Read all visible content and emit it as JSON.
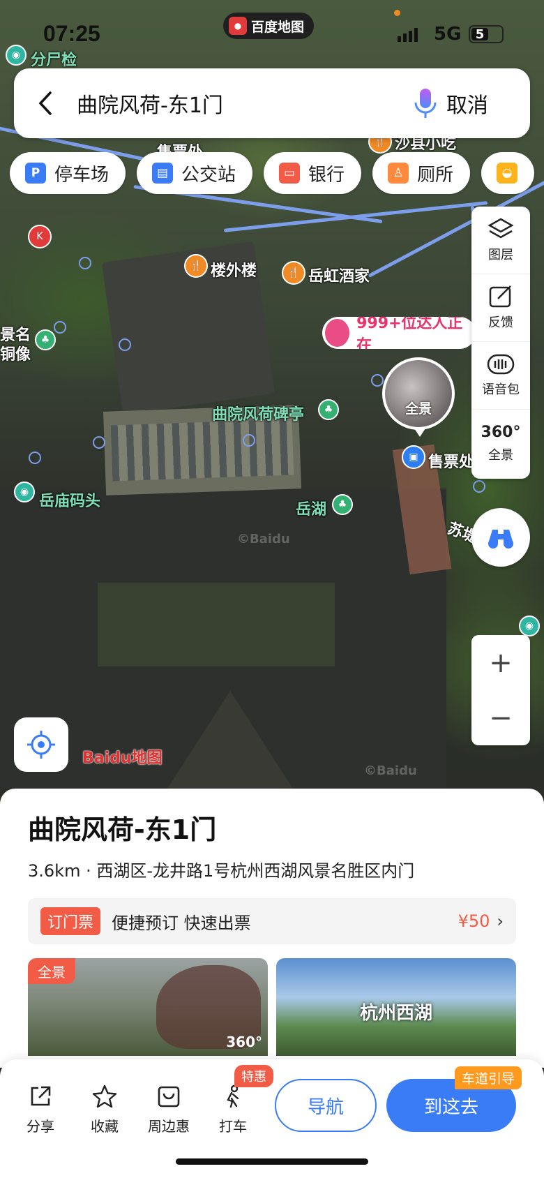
{
  "status_bar": {
    "time": "07:25",
    "app_name": "百度地图",
    "network": "5G",
    "battery": "5"
  },
  "search": {
    "query": "曲院风荷-东1门",
    "cancel_label": "取消"
  },
  "categories": [
    {
      "label": "停车场",
      "icon": "parking-icon",
      "color": "#3a7cf5"
    },
    {
      "label": "公交站",
      "icon": "bus-stop-icon",
      "color": "#3a7cf5"
    },
    {
      "label": "银行",
      "icon": "bank-card-icon",
      "color": "#f25b45"
    },
    {
      "label": "厕所",
      "icon": "toilet-icon",
      "color": "#ff8a3d"
    }
  ],
  "tools": {
    "layers": "图层",
    "feedback": "反馈",
    "voice_pack": "语音包",
    "panorama": "全景",
    "panorama_360": "360°"
  },
  "map_labels": {
    "fenshijian": "分尸检",
    "shoupiao_top": "售票处",
    "shaxian": "沙县小吃",
    "louwailou": "楼外楼",
    "yuehong": "岳虹酒家",
    "jingming_1": "景名",
    "jingming_2": "铜像",
    "quyuan_stele": "曲院风荷碑亭",
    "shoupiao": "售票处",
    "yuemiao_pier": "岳庙码头",
    "yuehu": "岳湖",
    "sudi": "苏堤",
    "promo": "999+位达人正在",
    "pano_label": "全景",
    "watermark": "©Baidu"
  },
  "place": {
    "name": "曲院风荷-东1门",
    "address": "3.6km · 西湖区-龙井路1号杭州西湖风景名胜区内门",
    "ticket_badge": "订门票",
    "ticket_text": "便捷预订 快速出票",
    "ticket_price": "¥50",
    "photo1_tag": "全景",
    "photo1_badge": "360°",
    "photo2_title": "杭州西湖"
  },
  "actions": {
    "share": "分享",
    "favorite": "收藏",
    "nearby": "周边惠",
    "taxi": "打车",
    "taxi_badge": "特惠",
    "navigate": "导航",
    "go_here": "到这去",
    "lane_guide": "车道引导"
  },
  "logo_text": "Baidu地图"
}
